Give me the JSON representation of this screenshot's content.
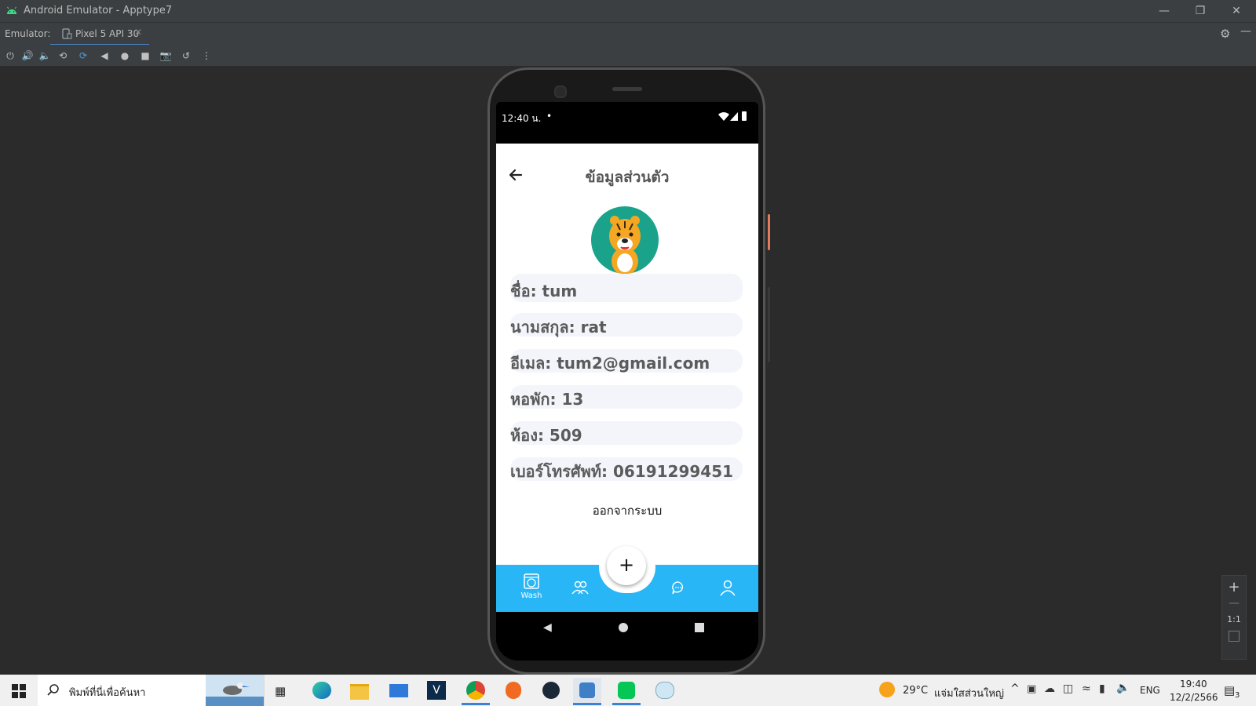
{
  "window": {
    "title": "Android Emulator - Apptype7",
    "tab_label_prefix": "Emulator:",
    "tab_device": "Pixel 5 API 30"
  },
  "phone": {
    "status": {
      "time": "12:40 น.",
      "dot": "•"
    },
    "app": {
      "header_title": "ข้อมูลส่วนตัว",
      "fields": [
        {
          "label": "ชื่อ: tum"
        },
        {
          "label": "นามสกุล: rat"
        },
        {
          "label": "อีเมล: tum2@gmail.com"
        },
        {
          "label": "หอพัก: 13"
        },
        {
          "label": "ห้อง: 509"
        },
        {
          "label": "เบอร์โทรศัพท์: 06191299451"
        }
      ],
      "logout_label": "ออกจากระบบ",
      "fab_label": "+",
      "bottom_nav": [
        {
          "icon": "washer-icon",
          "label": "Wash"
        },
        {
          "icon": "users-icon",
          "label": ""
        },
        {
          "icon": "chat-icon",
          "label": ""
        },
        {
          "icon": "profile-icon",
          "label": ""
        }
      ],
      "accent_color": "#29b6f6"
    }
  },
  "zoom_panel": {
    "plus": "+",
    "minus": "—",
    "ratio": "1:1"
  },
  "taskbar": {
    "search_placeholder": "พิมพ์ที่นี่เพื่อค้นหา",
    "weather": "29°C",
    "weather_text": "แจ่มใสส่วนใหญ่",
    "lang": "ENG",
    "time": "19:40",
    "date": "12/2/2566",
    "notif_count": "3"
  }
}
